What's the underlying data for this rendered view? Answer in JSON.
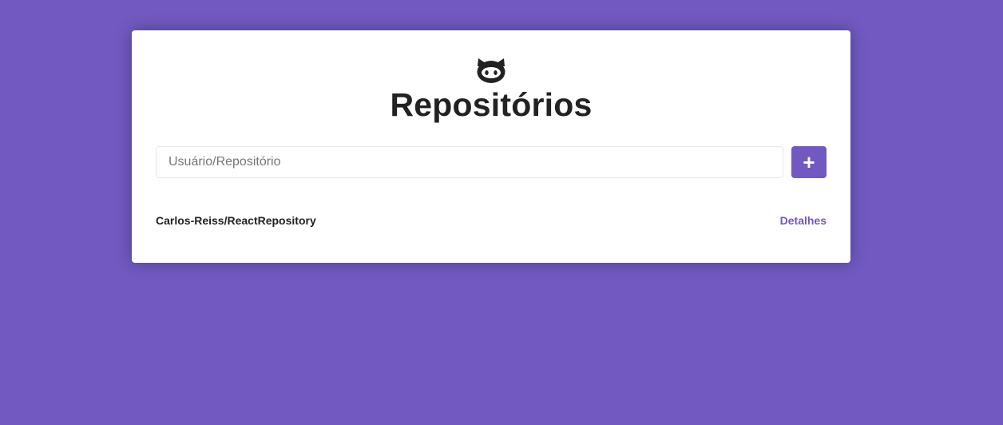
{
  "colors": {
    "background": "#7159c1",
    "card": "#ffffff",
    "accent": "#7159c1",
    "text": "#222222"
  },
  "header": {
    "icon": "github-icon",
    "title": "Repositórios"
  },
  "form": {
    "placeholder": "Usuário/Repositório",
    "value": "",
    "add_button_label": "+"
  },
  "repositories": [
    {
      "name": "Carlos-Reiss/ReactRepository",
      "link_label": "Detalhes"
    }
  ]
}
